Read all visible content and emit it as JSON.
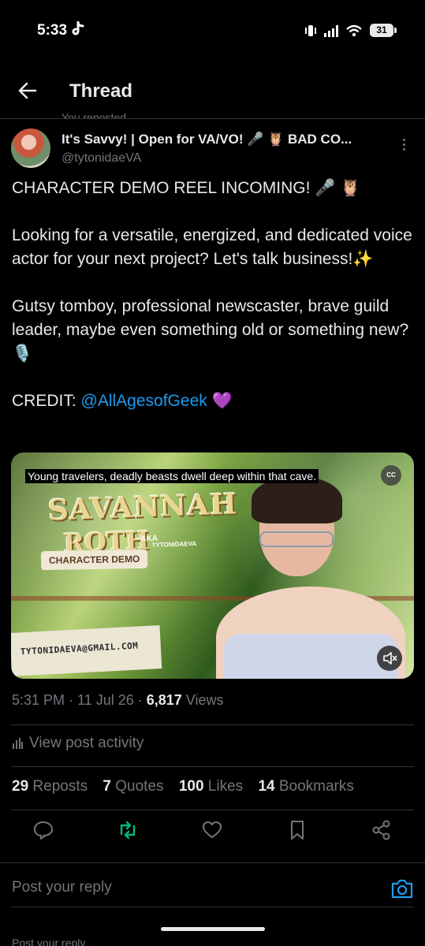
{
  "status_bar": {
    "time": "5:33",
    "app_glyph": "tiktok-icon",
    "battery": "31"
  },
  "header": {
    "title": "Thread"
  },
  "context_line": "You reposted",
  "post": {
    "display_name": "It's Savvy! | Open for VA/VO! 🎤 🦉 BAD CO...",
    "handle": "@tytonidaeVA",
    "lines": [
      "CHARACTER DEMO REEL INCOMING! 🎤 🦉",
      "Looking for a versatile, energized, and dedicated voice actor for your next project? Let's talk business!✨",
      "Gutsy tomboy, professional newscaster, brave guild leader, maybe even something old or something new?🎙️"
    ],
    "credit_label": "CREDIT: ",
    "credit_mention": "@AllAgesofGeek",
    "credit_emoji": " 💜",
    "media": {
      "caption": "Young travelers, deadly beasts dwell deep within that cave.",
      "cc_label": "CC",
      "logo_line1": "SAVANNAH",
      "logo_line2": "ROTH",
      "aka": "AKA",
      "aka_sub": "TYTONIDAEVA",
      "badge": "CHARACTER DEMO",
      "email": "TYTONIDAEVA@GMAIL.COM"
    },
    "timestamp": "5:31 PM · 11 Jul 26 · ",
    "views_count": "6,817",
    "views_label": " Views",
    "activity_label": "View post activity",
    "stats": {
      "reposts_count": "29",
      "reposts_label": "Reposts",
      "quotes_count": "7",
      "quotes_label": "Quotes",
      "likes_count": "100",
      "likes_label": "Likes",
      "bookmarks_count": "14",
      "bookmarks_label": "Bookmarks"
    }
  },
  "reply": {
    "placeholder": "Post your reply",
    "ghost_text": "Post your reply"
  },
  "colors": {
    "accent": "#1d9bf0",
    "repost_active": "#00ba7c",
    "muted": "#71767b",
    "text": "#e7e9ea"
  }
}
